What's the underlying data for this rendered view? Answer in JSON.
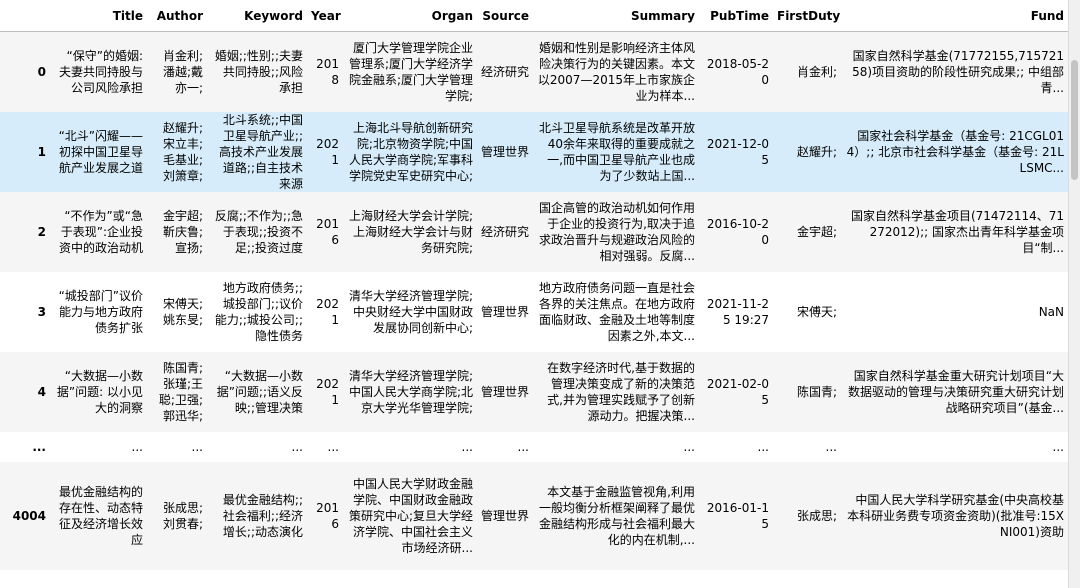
{
  "columns": [
    "",
    "Title",
    "Author",
    "Keyword",
    "Year",
    "Organ",
    "Source",
    "Summary",
    "PubTime",
    "FirstDuty",
    "Fund"
  ],
  "rows": [
    {
      "index": "0",
      "title": "“保守”的婚姻: 夫妻共同持股与公司风险承担",
      "author": "肖金利;潘越;戴亦一;",
      "keyword": "婚姻;;性别;;夫妻共同持股;;风险承担",
      "year": "2018",
      "organ": "厦门大学管理学院企业管理系;厦门大学经济学院金融系;厦门大学管理学院;",
      "source": "经济研究",
      "summary": "婚姻和性别是影响经济主体风险决策行为的关键因素。本文以2007—2015年上市家族企业为样本...",
      "pubtime": "2018-05-20",
      "firstduty": "肖金利;",
      "fund": "国家自然科学基金(71772155,71572158)项目资助的阶段性研究成果;; 中组部青..."
    },
    {
      "index": "1",
      "title": "“北斗”闪耀——初探中国卫星导航产业发展之道",
      "author": "赵耀升;宋立丰;毛基业;刘箫章;",
      "keyword": "北斗系统;;中国卫星导航产业;;高技术产业发展道路;;自主技术来源",
      "year": "2021",
      "organ": "上海北斗导航创新研究院;北京物资学院;中国人民大学商学院;军事科学院党史军史研究中心;",
      "source": "管理世界",
      "summary": "北斗卫星导航系统是改革开放40余年来取得的重要成就之一,而中国卫星导航产业也成为了少数站上国...",
      "pubtime": "2021-12-05",
      "firstduty": "赵耀升;",
      "fund": "国家社会科学基金（基金号: 21CGL014）;; 北京市社会科学基金（基金号: 21LLSMC..."
    },
    {
      "index": "2",
      "title": "“不作为”或“急于表现”:企业投资中的政治动机",
      "author": "金宇超;靳庆鲁;宣扬;",
      "keyword": "反腐;;不作为;;急于表现;;投资不足;;投资过度",
      "year": "2016",
      "organ": "上海财经大学会计学院;上海财经大学会计与财务研究院;",
      "source": "经济研究",
      "summary": "国企高管的政治动机如何作用于企业的投资行为,取决于追求政治晋升与规避政治风险的相对强弱。反腐...",
      "pubtime": "2016-10-20",
      "firstduty": "金宇超;",
      "fund": "国家自然科学基金项目(71472114、71272012);; 国家杰出青年科学基金项目“制..."
    },
    {
      "index": "3",
      "title": "“城投部门”议价能力与地方政府债务扩张",
      "author": "宋傅天;姚东旻;",
      "keyword": "地方政府债务;;城投部门;;议价能力;;城投公司;;隐性债务",
      "year": "2021",
      "organ": "清华大学经济管理学院;中央财经大学中国财政发展协同创新中心;",
      "source": "管理世界",
      "summary": "地方政府债务问题一直是社会各界的关注焦点。在地方政府面临财政、金融及土地等制度因素之外,本文...",
      "pubtime": "2021-11-25 19:27",
      "firstduty": "宋傅天;",
      "fund": "NaN"
    },
    {
      "index": "4",
      "title": "“大数据—小数据”问题: 以小见大的洞察",
      "author": "陈国青;张瑾;王聪;卫强;郭迅华;",
      "keyword": "“大数据—小数据”问题;;语义反映;;管理决策",
      "year": "2021",
      "organ": "清华大学经济管理学院;中国人民大学商学院;北京大学光华管理学院;",
      "source": "管理世界",
      "summary": "在数字经济时代,基于数据的管理决策变成了新的决策范式,并为管理实践赋予了创新源动力。把握决策...",
      "pubtime": "2021-02-05",
      "firstduty": "陈国青;",
      "fund": "国家自然科学基金重大研究计划项目“大数据驱动的管理与决策研究重大研究计划战略研究项目”(基金..."
    },
    {
      "index": "...",
      "title": "...",
      "author": "...",
      "keyword": "...",
      "year": "...",
      "organ": "...",
      "source": "...",
      "summary": "...",
      "pubtime": "...",
      "firstduty": "...",
      "fund": "..."
    },
    {
      "index": "4004",
      "title": "最优金融结构的存在性、动态特征及经济增长效应",
      "author": "张成思;刘贯春;",
      "keyword": "最优金融结构;;社会福利;;经济增长;;动态演化",
      "year": "2016",
      "organ": "中国人民大学财政金融学院、中国财政金融政策研究中心;复旦大学经济学院、中国社会主义市场经济研...",
      "source": "管理世界",
      "summary": "本文基于金融监管视角,利用一般均衡分析框架阐释了最优金融结构形成与社会福利最大化的内在机制,...",
      "pubtime": "2016-01-15",
      "firstduty": "张成思;",
      "fund": "中国人民大学科学研究基金(中央高校基本科研业务费专项资金资助)(批准号:15XNI001)资助"
    }
  ]
}
